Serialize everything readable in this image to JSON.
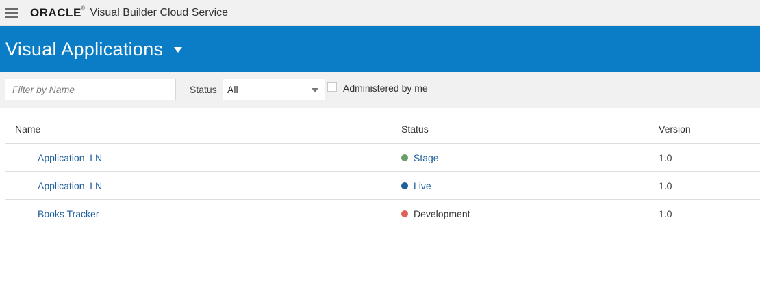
{
  "app": {
    "logo_text": "ORACLE",
    "service_name": "Visual Builder Cloud Service"
  },
  "banner": {
    "title": "Visual Applications"
  },
  "filters": {
    "name_placeholder": "Filter by Name",
    "status_label": "Status",
    "status_selected": "All",
    "administered_label": "Administered by me"
  },
  "table": {
    "headers": {
      "name": "Name",
      "status": "Status",
      "version": "Version"
    },
    "rows": [
      {
        "name": "Application_LN",
        "status": "Stage",
        "status_color": "#6a9f6a",
        "version": "1.0"
      },
      {
        "name": "Application_LN",
        "status": "Live",
        "status_color": "#1f5f9c",
        "version": "1.0"
      },
      {
        "name": "Books Tracker",
        "status": "Development",
        "status_color": "#e0605a",
        "version": "1.0"
      }
    ]
  },
  "colors": {
    "banner": "#0b7dc6",
    "link": "#1f5f9c"
  }
}
